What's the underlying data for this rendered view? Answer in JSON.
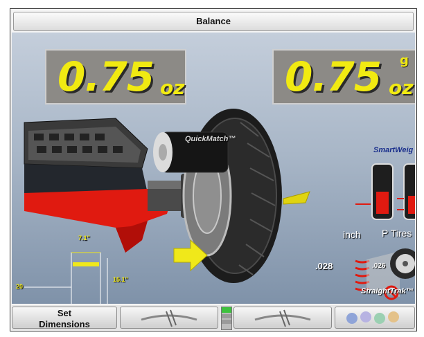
{
  "window": {
    "title": "Balance"
  },
  "readouts": {
    "left": {
      "value": "0.75",
      "unit": "oz"
    },
    "right": {
      "value": "0.75",
      "unit": "oz",
      "secondary_unit": "g"
    }
  },
  "scene": {
    "quickmatch_label": "QuickMatch™",
    "smartweight_label": "SmartWeig",
    "runout": {
      "unit_label": "inch",
      "tire_type_label": "P Tires",
      "left_value": ".028",
      "right_value": ".026",
      "straighttrak_label": "StraightTrak™ L"
    },
    "rim_dims": {
      "width": "7.1\"",
      "diameter": "15.1\"",
      "offset": "20"
    }
  },
  "toolbar": {
    "set_dimensions_line1": "Set",
    "set_dimensions_line2": "Dimensions"
  },
  "colors": {
    "readout_text": "#f1ea12",
    "weight_red": "#e01a10",
    "arrow_yellow": "#f0e81a"
  }
}
